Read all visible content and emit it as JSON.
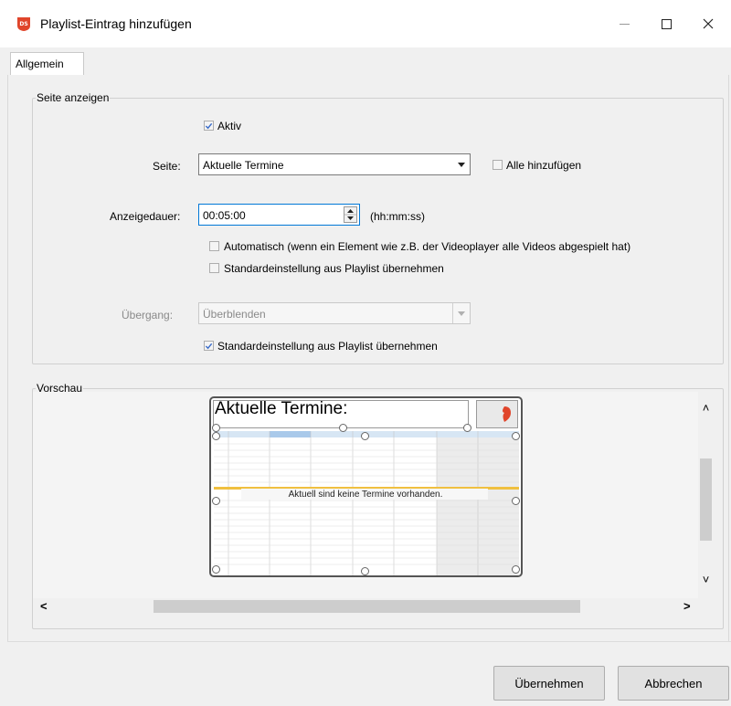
{
  "window": {
    "title": "Playlist-Eintrag hinzufügen",
    "minimize": "—",
    "maximize": "☐",
    "close": "✕"
  },
  "tabs": [
    {
      "label": "Allgemein",
      "selected": true
    }
  ],
  "group_show_page": {
    "legend": "Seite anzeigen",
    "aktiv": {
      "label": "Aktiv",
      "checked": true
    },
    "seite": {
      "label": "Seite:",
      "value": "Aktuelle Termine"
    },
    "alle_hinzufuegen": {
      "label": "Alle hinzufügen",
      "checked": false
    },
    "anzeigedauer": {
      "label": "Anzeigedauer:",
      "value": "00:05:00",
      "hint": "(hh:mm:ss)"
    },
    "automatisch": {
      "label": "Automatisch (wenn ein Element wie z.B. der Videoplayer alle Videos abgespielt hat)",
      "checked": false
    },
    "standard_dauer": {
      "label": "Standardeinstellung aus Playlist übernehmen",
      "checked": false
    },
    "uebergang": {
      "label": "Übergang:",
      "value": "Überblenden",
      "disabled": true
    },
    "standard_uebergang": {
      "label": "Standardeinstellung aus Playlist übernehmen",
      "checked": true
    }
  },
  "group_preview": {
    "legend": "Vorschau",
    "preview_title": "Aktuelle Termine:",
    "no_events": "Aktuell sind keine Termine vorhanden.",
    "scroll_up": "˄",
    "scroll_down": "˅",
    "scroll_left": "<",
    "scroll_right": ">"
  },
  "buttons": {
    "apply": "Übernehmen",
    "cancel": "Abbrechen"
  },
  "colors": {
    "accent_icon": "#e0452b",
    "check": "#3d6ec9",
    "calendar_header": "#d7e6f4",
    "today_line": "#f0c040"
  }
}
